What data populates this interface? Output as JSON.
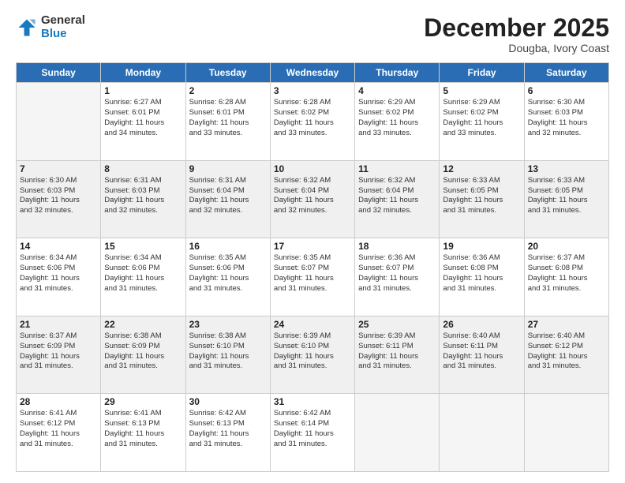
{
  "logo": {
    "general": "General",
    "blue": "Blue"
  },
  "title": "December 2025",
  "location": "Dougba, Ivory Coast",
  "headers": [
    "Sunday",
    "Monday",
    "Tuesday",
    "Wednesday",
    "Thursday",
    "Friday",
    "Saturday"
  ],
  "weeks": [
    [
      {
        "day": "",
        "info": ""
      },
      {
        "day": "1",
        "info": "Sunrise: 6:27 AM\nSunset: 6:01 PM\nDaylight: 11 hours\nand 34 minutes."
      },
      {
        "day": "2",
        "info": "Sunrise: 6:28 AM\nSunset: 6:01 PM\nDaylight: 11 hours\nand 33 minutes."
      },
      {
        "day": "3",
        "info": "Sunrise: 6:28 AM\nSunset: 6:02 PM\nDaylight: 11 hours\nand 33 minutes."
      },
      {
        "day": "4",
        "info": "Sunrise: 6:29 AM\nSunset: 6:02 PM\nDaylight: 11 hours\nand 33 minutes."
      },
      {
        "day": "5",
        "info": "Sunrise: 6:29 AM\nSunset: 6:02 PM\nDaylight: 11 hours\nand 33 minutes."
      },
      {
        "day": "6",
        "info": "Sunrise: 6:30 AM\nSunset: 6:03 PM\nDaylight: 11 hours\nand 32 minutes."
      }
    ],
    [
      {
        "day": "7",
        "info": "Sunrise: 6:30 AM\nSunset: 6:03 PM\nDaylight: 11 hours\nand 32 minutes."
      },
      {
        "day": "8",
        "info": "Sunrise: 6:31 AM\nSunset: 6:03 PM\nDaylight: 11 hours\nand 32 minutes."
      },
      {
        "day": "9",
        "info": "Sunrise: 6:31 AM\nSunset: 6:04 PM\nDaylight: 11 hours\nand 32 minutes."
      },
      {
        "day": "10",
        "info": "Sunrise: 6:32 AM\nSunset: 6:04 PM\nDaylight: 11 hours\nand 32 minutes."
      },
      {
        "day": "11",
        "info": "Sunrise: 6:32 AM\nSunset: 6:04 PM\nDaylight: 11 hours\nand 32 minutes."
      },
      {
        "day": "12",
        "info": "Sunrise: 6:33 AM\nSunset: 6:05 PM\nDaylight: 11 hours\nand 31 minutes."
      },
      {
        "day": "13",
        "info": "Sunrise: 6:33 AM\nSunset: 6:05 PM\nDaylight: 11 hours\nand 31 minutes."
      }
    ],
    [
      {
        "day": "14",
        "info": "Sunrise: 6:34 AM\nSunset: 6:06 PM\nDaylight: 11 hours\nand 31 minutes."
      },
      {
        "day": "15",
        "info": "Sunrise: 6:34 AM\nSunset: 6:06 PM\nDaylight: 11 hours\nand 31 minutes."
      },
      {
        "day": "16",
        "info": "Sunrise: 6:35 AM\nSunset: 6:06 PM\nDaylight: 11 hours\nand 31 minutes."
      },
      {
        "day": "17",
        "info": "Sunrise: 6:35 AM\nSunset: 6:07 PM\nDaylight: 11 hours\nand 31 minutes."
      },
      {
        "day": "18",
        "info": "Sunrise: 6:36 AM\nSunset: 6:07 PM\nDaylight: 11 hours\nand 31 minutes."
      },
      {
        "day": "19",
        "info": "Sunrise: 6:36 AM\nSunset: 6:08 PM\nDaylight: 11 hours\nand 31 minutes."
      },
      {
        "day": "20",
        "info": "Sunrise: 6:37 AM\nSunset: 6:08 PM\nDaylight: 11 hours\nand 31 minutes."
      }
    ],
    [
      {
        "day": "21",
        "info": "Sunrise: 6:37 AM\nSunset: 6:09 PM\nDaylight: 11 hours\nand 31 minutes."
      },
      {
        "day": "22",
        "info": "Sunrise: 6:38 AM\nSunset: 6:09 PM\nDaylight: 11 hours\nand 31 minutes."
      },
      {
        "day": "23",
        "info": "Sunrise: 6:38 AM\nSunset: 6:10 PM\nDaylight: 11 hours\nand 31 minutes."
      },
      {
        "day": "24",
        "info": "Sunrise: 6:39 AM\nSunset: 6:10 PM\nDaylight: 11 hours\nand 31 minutes."
      },
      {
        "day": "25",
        "info": "Sunrise: 6:39 AM\nSunset: 6:11 PM\nDaylight: 11 hours\nand 31 minutes."
      },
      {
        "day": "26",
        "info": "Sunrise: 6:40 AM\nSunset: 6:11 PM\nDaylight: 11 hours\nand 31 minutes."
      },
      {
        "day": "27",
        "info": "Sunrise: 6:40 AM\nSunset: 6:12 PM\nDaylight: 11 hours\nand 31 minutes."
      }
    ],
    [
      {
        "day": "28",
        "info": "Sunrise: 6:41 AM\nSunset: 6:12 PM\nDaylight: 11 hours\nand 31 minutes."
      },
      {
        "day": "29",
        "info": "Sunrise: 6:41 AM\nSunset: 6:13 PM\nDaylight: 11 hours\nand 31 minutes."
      },
      {
        "day": "30",
        "info": "Sunrise: 6:42 AM\nSunset: 6:13 PM\nDaylight: 11 hours\nand 31 minutes."
      },
      {
        "day": "31",
        "info": "Sunrise: 6:42 AM\nSunset: 6:14 PM\nDaylight: 11 hours\nand 31 minutes."
      },
      {
        "day": "",
        "info": ""
      },
      {
        "day": "",
        "info": ""
      },
      {
        "day": "",
        "info": ""
      }
    ]
  ]
}
